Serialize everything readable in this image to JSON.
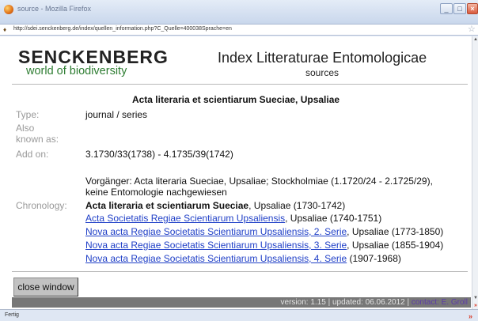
{
  "browser": {
    "window_title": "source - Mozilla Firefox",
    "url": "http://sdei.senckenberg.de/index/quellen_information.php?C_Quelle=400038Sprache=en",
    "status": "Fertig"
  },
  "header": {
    "brand": "SENCKENBERG",
    "tagline": "world of biodiversity",
    "index_title": "Index Litteraturae Entomologicae",
    "subtitle": "sources"
  },
  "record": {
    "title": "Acta literaria et scientiarum Sueciae, Upsaliae",
    "labels": {
      "type": "Type:",
      "also_known_as": "Also known as:",
      "add_on": "Add on:",
      "chronology": "Chronology:"
    },
    "type": "journal / series",
    "add_on": "3.1730/33(1738) - 4.1735/39(1742)",
    "predecessor_line1": "Vorgänger: Acta literaria Sueciae, Upsaliae; Stockholmiae (1.1720/24 - 2.1725/29),",
    "predecessor_line2": "keine Entomologie nachgewiesen",
    "chronology": [
      {
        "name": "Acta literaria et scientiarum Sueciae",
        "rest": ", Upsaliae (1730-1742)"
      },
      {
        "name": "Acta Societatis Regiae Scientiarum Upsaliensis",
        "rest": ", Upsaliae (1740-1751)"
      },
      {
        "name": "Nova acta Regiae Societatis Scientiarum Upsaliensis, 2. Serie",
        "rest": ", Upsaliae (1773-1850)"
      },
      {
        "name": "Nova acta Regiae Societatis Scientiarum Upsaliensis, 3. Serie",
        "rest": ", Upsaliae (1855-1904)"
      },
      {
        "name": "Nova acta Regiae Societatis Scientiarum Upsaliensis, 4. Serie",
        "rest": " (1907-1968)"
      }
    ]
  },
  "actions": {
    "close_window": "close window"
  },
  "footer": {
    "version_text": "version: 1.15 | updated: 06.06.2012 | ",
    "contact": "contact: E. Groll"
  }
}
